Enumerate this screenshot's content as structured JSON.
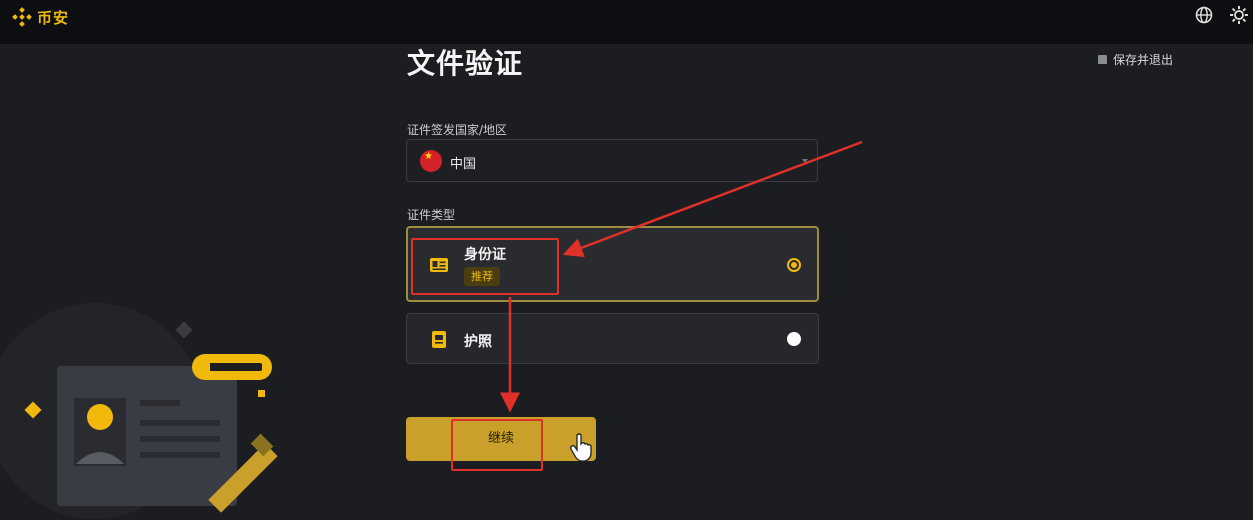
{
  "brand": {
    "name": "币安",
    "color": "#f0b90b"
  },
  "header": {
    "icons": [
      "globe-icon",
      "theme-settings-icon"
    ],
    "save_exit_label": "保存并退出"
  },
  "form": {
    "title": "文件验证",
    "country_label": "证件签发国家/地区",
    "country_value": "中国",
    "doc_type_label": "证件类型",
    "options": [
      {
        "label": "身份证",
        "badge": "推荐",
        "selected": true,
        "icon": "id-card-icon"
      },
      {
        "label": "护照",
        "badge": "",
        "selected": false,
        "icon": "passport-icon"
      }
    ],
    "continue_label": "继续"
  },
  "colors": {
    "accent": "#f0b90b",
    "annotation": "#e0302a",
    "background": "#1c1d21"
  }
}
